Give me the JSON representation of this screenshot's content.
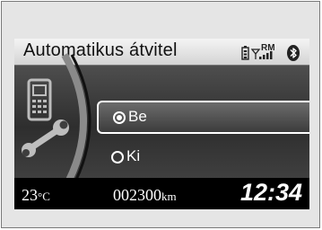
{
  "header": {
    "title": "Automatikus átvitel",
    "roaming_label": "RM",
    "icons": [
      "phone-battery-icon",
      "signal-icon",
      "bluetooth-icon"
    ]
  },
  "menu": {
    "illustration": "phone-wrench-icon",
    "options": [
      {
        "label": "Be",
        "selected": true
      },
      {
        "label": "Ki",
        "selected": false
      }
    ]
  },
  "footer": {
    "temperature_value": "23",
    "temperature_unit": "°C",
    "odometer_value": "002300",
    "odometer_unit": "km",
    "clock": "12:34"
  },
  "colors": {
    "header_bg": "#e0e0e0",
    "screen_bg": "#000000",
    "highlight_border": "#ffffff"
  }
}
